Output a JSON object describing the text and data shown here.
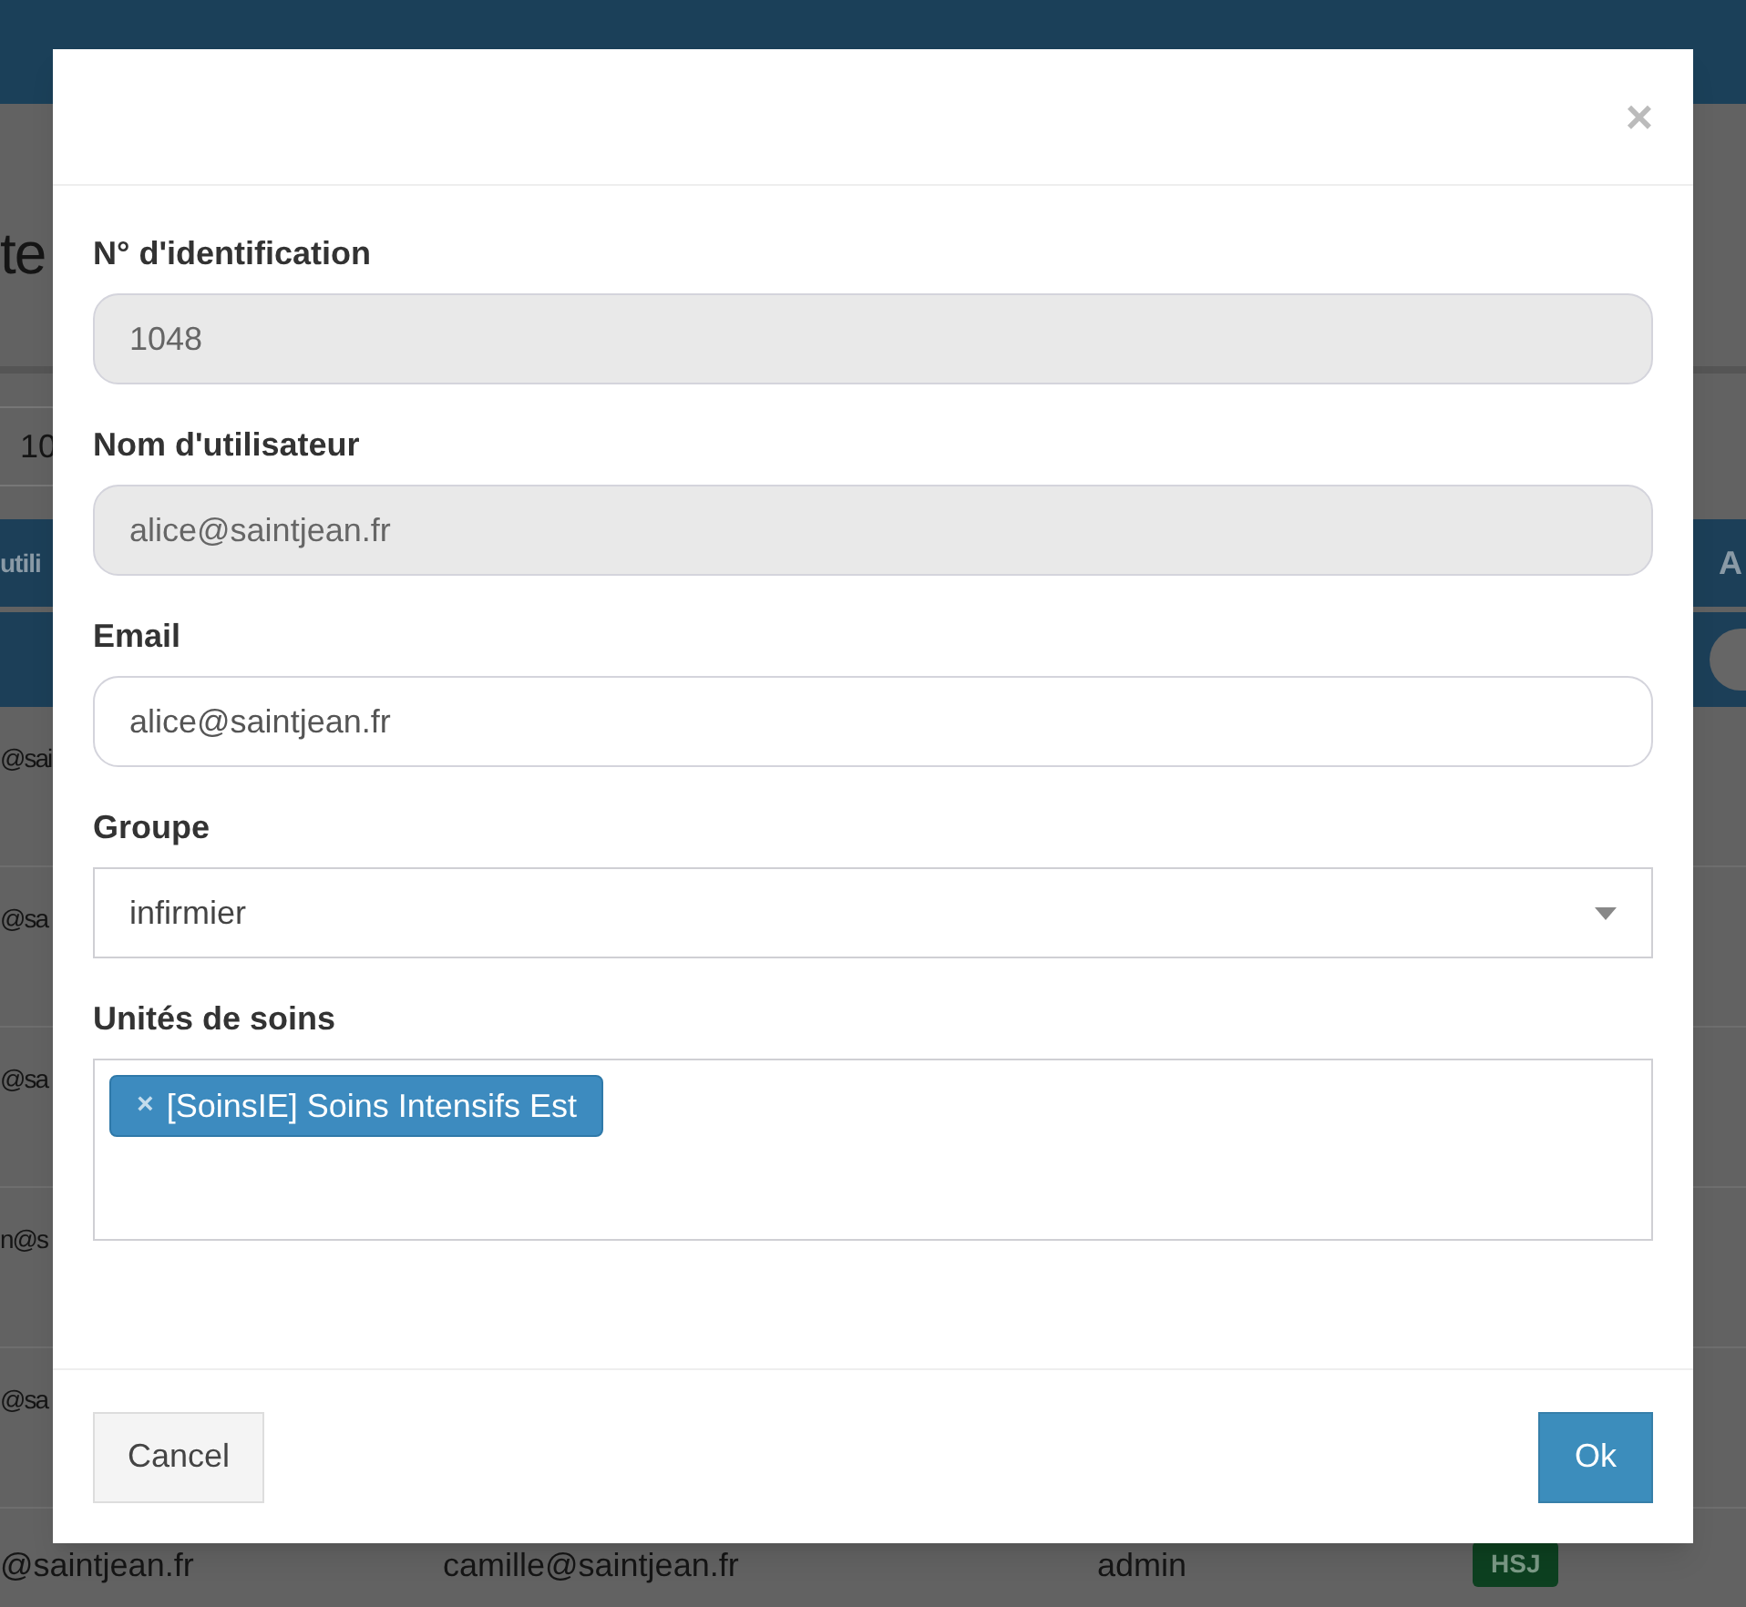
{
  "background": {
    "title": "te",
    "page_size": "10",
    "table_header": [
      {
        "label": "utili"
      },
      {
        "label": "A"
      }
    ],
    "rows": [
      {
        "cells": [
          "@sai"
        ]
      },
      {
        "cells": [
          "@sa"
        ]
      },
      {
        "cells": [
          "@sa"
        ]
      },
      {
        "cells": [
          "n@s"
        ]
      },
      {
        "cells": [
          "@sa"
        ]
      },
      {
        "cells": [
          "@saintjean.fr",
          "camille@saintjean.fr",
          "admin"
        ],
        "badge": "HSJ"
      }
    ]
  },
  "modal": {
    "close": "×",
    "fields": [
      {
        "kind": "input",
        "label": "N° d'identification",
        "value": "1048",
        "disabled": true
      },
      {
        "kind": "input",
        "label": "Nom d'utilisateur",
        "value": "alice@saintjean.fr",
        "disabled": true
      },
      {
        "kind": "input",
        "label": "Email",
        "value": "alice@saintjean.fr",
        "disabled": false
      },
      {
        "kind": "select",
        "label": "Groupe",
        "value": "infirmier"
      },
      {
        "kind": "tags",
        "label": "Unités de soins",
        "tags": [
          {
            "remove": "×",
            "label": "[SoinsIE] Soins Intensifs Est"
          }
        ]
      }
    ],
    "buttons": {
      "cancel": "Cancel",
      "ok": "Ok"
    }
  }
}
